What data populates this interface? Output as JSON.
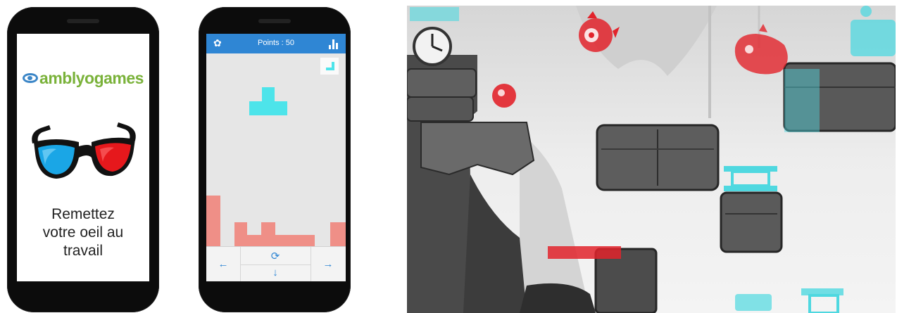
{
  "phone1": {
    "logo_text": "amblyogames",
    "tagline_lines": [
      "Remettez",
      "votre oeil au",
      "travail"
    ],
    "colors": {
      "logo_green": "#7ab23a",
      "logo_blue": "#3c86c7"
    }
  },
  "phone2": {
    "points_label": "Points : 50",
    "icons": [
      "gear-icon",
      "stats-icon",
      "arrow-left-icon",
      "rotate-icon",
      "arrow-down-icon",
      "arrow-right-icon"
    ],
    "controls": {
      "left": "←",
      "rotate": "⟳",
      "down": "↓",
      "right": "→"
    },
    "colors": {
      "bar": "#2f86d4",
      "piece": "#4de4ea",
      "stack": "#ef8f87"
    }
  },
  "game": {
    "colors": {
      "cyan": "#4fd8e0",
      "red": "#e2232b"
    },
    "icons": [
      "clock-icon",
      "red-creature-icon",
      "red-orb-icon",
      "spring-icon"
    ]
  }
}
